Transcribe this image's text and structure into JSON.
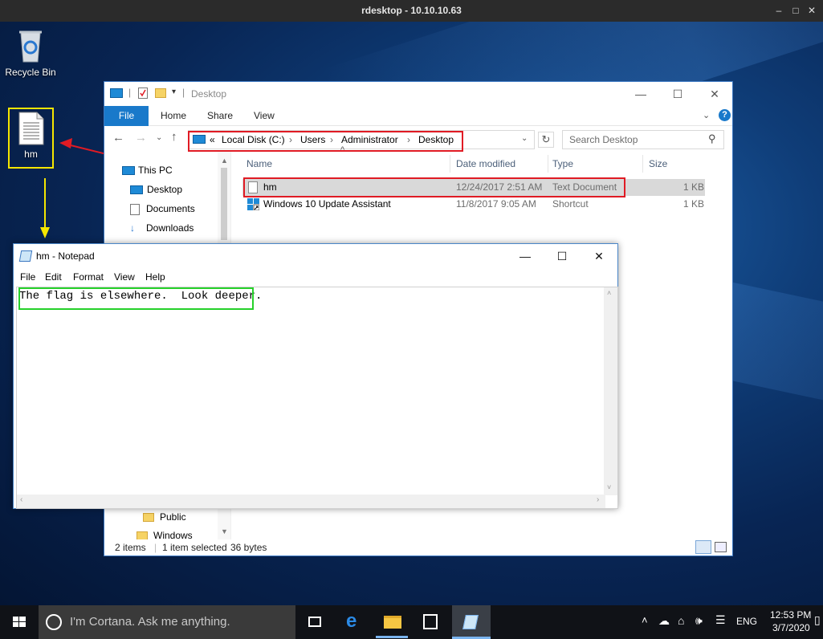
{
  "rdp": {
    "title": "rdesktop - 10.10.10.63",
    "minimize": "–",
    "maximize": "□",
    "close": "✕"
  },
  "desktop_icons": [
    {
      "name": "recycle-bin",
      "label": "Recycle Bin",
      "icon": "recycle-bin-icon"
    },
    {
      "name": "hm-file",
      "label": "hm",
      "icon": "text-file-icon"
    }
  ],
  "explorer": {
    "title": "Desktop",
    "ribbon_tabs": [
      "File",
      "Home",
      "Share",
      "View"
    ],
    "address": {
      "overflow": "«",
      "crumbs": [
        "Local Disk (C:)",
        "Users",
        "Administrator",
        "Desktop"
      ],
      "separator": "›"
    },
    "search_placeholder": "Search Desktop",
    "nav_items": [
      {
        "label": "This PC",
        "icon": "this-pc-icon"
      },
      {
        "label": "Desktop",
        "icon": "desktop-folder-icon"
      },
      {
        "label": "Documents",
        "icon": "documents-icon"
      },
      {
        "label": "Downloads",
        "icon": "downloads-icon"
      },
      {
        "label": "Public",
        "icon": "folder-icon"
      },
      {
        "label": "Windows",
        "icon": "folder-icon"
      }
    ],
    "columns": [
      "Name",
      "Date modified",
      "Type",
      "Size"
    ],
    "files": [
      {
        "name": "hm",
        "date": "12/24/2017 2:51 AM",
        "type": "Text Document",
        "size": "1 KB",
        "selected": true,
        "icon": "text-file-icon"
      },
      {
        "name": "Windows 10 Update Assistant",
        "date": "11/8/2017 9:05 AM",
        "type": "Shortcut",
        "size": "1 KB",
        "selected": false,
        "icon": "shortcut-icon"
      }
    ],
    "status": {
      "items": "2 items",
      "selected": "1 item selected",
      "size": "36 bytes"
    }
  },
  "notepad": {
    "title": "hm - Notepad",
    "menu": [
      "File",
      "Edit",
      "Format",
      "View",
      "Help"
    ],
    "content": "The flag is elsewhere.  Look deeper."
  },
  "taskbar": {
    "cortana_placeholder": "I'm Cortana. Ask me anything.",
    "lang": "ENG",
    "time": "12:53 PM",
    "date": "3/7/2020"
  },
  "colors": {
    "annotation_red": "#e01b24",
    "annotation_green": "#26d12a",
    "annotation_yellow": "#f5e600",
    "file_tab": "#1979ca"
  }
}
